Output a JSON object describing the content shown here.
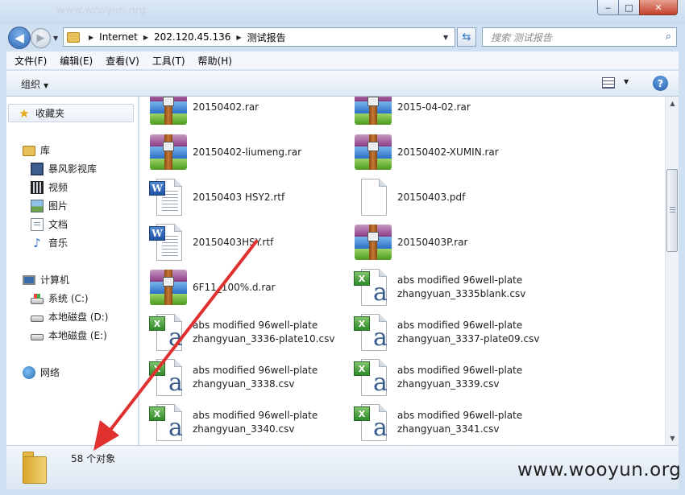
{
  "window": {
    "title_watermark": "www.wooyun.org",
    "min_label": "‒",
    "max_label": "□",
    "close_label": "✕"
  },
  "nav": {
    "back_glyph": "◀",
    "forward_glyph": "▶",
    "breadcrumb": [
      "Internet",
      "202.120.45.136",
      "测试报告"
    ],
    "refresh_glyph": "⇆",
    "search_placeholder": "搜索 测试报告",
    "search_glyph": "⌕"
  },
  "menu": [
    "文件(F)",
    "编辑(E)",
    "查看(V)",
    "工具(T)",
    "帮助(H)"
  ],
  "commandbar": {
    "organize_label": "组织",
    "help_glyph": "?"
  },
  "sidebar": {
    "favorites": "收藏夹",
    "libraries": "库",
    "library_items": [
      "暴风影视库",
      "视频",
      "图片",
      "文档",
      "音乐"
    ],
    "computer": "计算机",
    "drives": [
      "系统 (C:)",
      "本地磁盘 (D:)",
      "本地磁盘 (E:)"
    ],
    "network": "网络"
  },
  "files": [
    {
      "type": "rar",
      "line1": "20150402.rar",
      "line2": ""
    },
    {
      "type": "rar",
      "line1": "2015-04-02.rar",
      "line2": ""
    },
    {
      "type": "rar",
      "line1": "20150402-liumeng.rar",
      "line2": ""
    },
    {
      "type": "rar",
      "line1": "20150402-XUMIN.rar",
      "line2": ""
    },
    {
      "type": "rtf",
      "line1": "20150403 HSY2.rtf",
      "line2": ""
    },
    {
      "type": "pdf",
      "line1": "20150403.pdf",
      "line2": ""
    },
    {
      "type": "rtf",
      "line1": "20150403HSY.rtf",
      "line2": ""
    },
    {
      "type": "rar",
      "line1": "20150403P.rar",
      "line2": ""
    },
    {
      "type": "rar",
      "line1": "6F11_100%.d.rar",
      "line2": ""
    },
    {
      "type": "csv",
      "line1": "abs modified 96well-plate",
      "line2": "zhangyuan_3335blank.csv"
    },
    {
      "type": "csv",
      "line1": "abs modified 96well-plate",
      "line2": "zhangyuan_3336-plate10.csv"
    },
    {
      "type": "csv",
      "line1": "abs modified 96well-plate",
      "line2": "zhangyuan_3337-plate09.csv"
    },
    {
      "type": "csv",
      "line1": "abs modified 96well-plate",
      "line2": "zhangyuan_3338.csv"
    },
    {
      "type": "csv",
      "line1": "abs modified 96well-plate",
      "line2": "zhangyuan_3339.csv"
    },
    {
      "type": "csv",
      "line1": "abs modified 96well-plate",
      "line2": "zhangyuan_3340.csv"
    },
    {
      "type": "csv",
      "line1": "abs modified 96well-plate",
      "line2": "zhangyuan_3341.csv"
    }
  ],
  "status": {
    "count_text": "58 个对象"
  },
  "watermark": "www.wooyun.org",
  "colors": {
    "annotation_arrow": "#e03030",
    "window_frame": "#cfe0f2"
  }
}
